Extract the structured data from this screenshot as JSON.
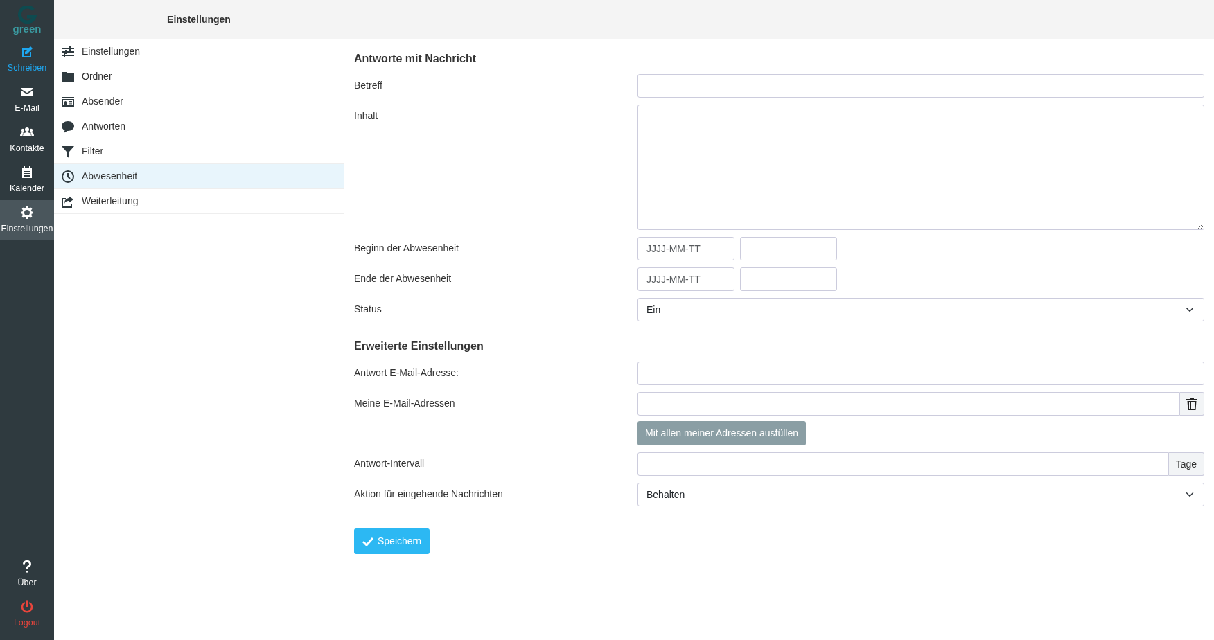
{
  "logo": {
    "text": "green"
  },
  "sidebar": {
    "items": [
      {
        "label": "Schreiben",
        "kind": "accent",
        "selected": false
      },
      {
        "label": "E-Mail",
        "kind": "plain",
        "selected": false
      },
      {
        "label": "Kontakte",
        "kind": "plain",
        "selected": false
      },
      {
        "label": "Kalender",
        "kind": "plain",
        "selected": false
      },
      {
        "label": "Einstellungen",
        "kind": "plain",
        "selected": true
      }
    ],
    "bottom_items": [
      {
        "label": "Über",
        "kind": "plain",
        "selected": false
      },
      {
        "label": "Logout",
        "kind": "danger",
        "selected": false
      }
    ]
  },
  "settings_panel": {
    "title": "Einstellungen",
    "items": [
      {
        "label": "Einstellungen",
        "selected": false
      },
      {
        "label": "Ordner",
        "selected": false
      },
      {
        "label": "Absender",
        "selected": false
      },
      {
        "label": "Antworten",
        "selected": false
      },
      {
        "label": "Filter",
        "selected": false
      },
      {
        "label": "Abwesenheit",
        "selected": true
      },
      {
        "label": "Weiterleitung",
        "selected": false
      }
    ]
  },
  "form": {
    "sections": [
      {
        "heading": "Antworte mit Nachricht",
        "rows": [
          {
            "kind": "text",
            "label": "Betreff"
          },
          {
            "kind": "textarea",
            "label": "Inhalt"
          },
          {
            "kind": "datetime",
            "label": "Beginn der Abwesenheit",
            "placeholder": "JJJJ-MM-TT"
          },
          {
            "kind": "datetime",
            "label": "Ende der Abwesenheit",
            "placeholder": "JJJJ-MM-TT"
          },
          {
            "kind": "select",
            "label": "Status",
            "value": "Ein"
          }
        ]
      },
      {
        "heading": "Erweiterte Einstellungen",
        "rows": [
          {
            "kind": "text",
            "label": "Antwort E-Mail-Adresse:"
          },
          {
            "kind": "trash",
            "label": "Meine E-Mail-Adressen",
            "button": "Mit allen meiner Adressen ausfüllen"
          },
          {
            "kind": "addon",
            "label": "Antwort-Intervall",
            "addon": "Tage"
          },
          {
            "kind": "select",
            "label": "Aktion für eingehende Nachrichten",
            "value": "Behalten"
          }
        ]
      }
    ],
    "save_button": "Speichern"
  }
}
